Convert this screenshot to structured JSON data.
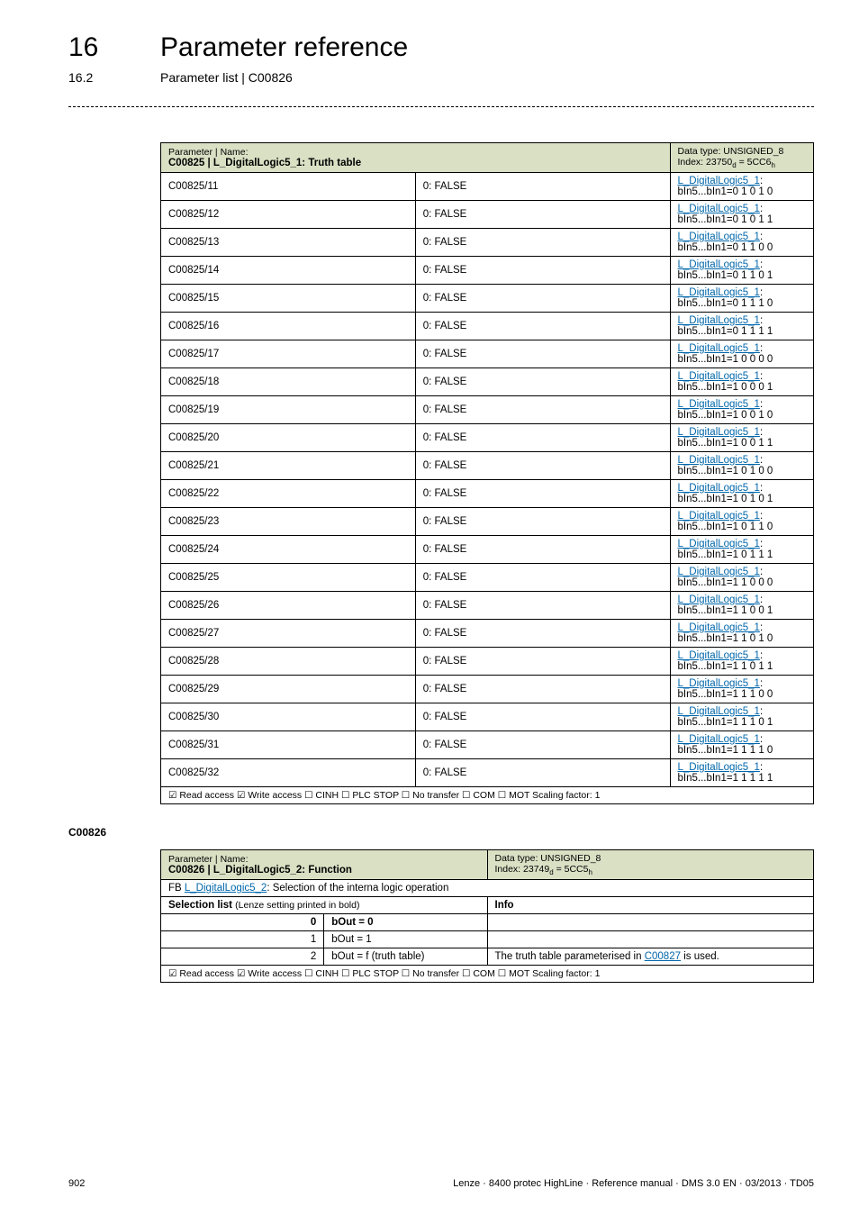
{
  "header": {
    "chapter_num": "16",
    "chapter_title": "Parameter reference",
    "section_num": "16.2",
    "section_title": "Parameter list | C00826"
  },
  "table1": {
    "param_label": "Parameter | Name:",
    "param_name": "C00825 | L_DigitalLogic5_1: Truth table",
    "datatype_label": "Data type: UNSIGNED_8",
    "index_prefix": "Index: 23750",
    "index_sub1": "d",
    "index_mid": " = 5CC6",
    "index_sub2": "h",
    "rows": [
      {
        "code": "C00825/11",
        "val": "0: FALSE",
        "link": "L_DigitalLogic5_1",
        "suffix": ": bIn5...bIn1=0 1 0 1 0"
      },
      {
        "code": "C00825/12",
        "val": "0: FALSE",
        "link": "L_DigitalLogic5_1",
        "suffix": ": bIn5...bIn1=0 1 0 1 1"
      },
      {
        "code": "C00825/13",
        "val": "0: FALSE",
        "link": "L_DigitalLogic5_1",
        "suffix": ": bIn5...bIn1=0 1 1 0 0"
      },
      {
        "code": "C00825/14",
        "val": "0: FALSE",
        "link": "L_DigitalLogic5_1",
        "suffix": ": bIn5...bIn1=0 1 1 0 1"
      },
      {
        "code": "C00825/15",
        "val": "0: FALSE",
        "link": "L_DigitalLogic5_1",
        "suffix": ": bIn5...bIn1=0 1 1 1 0"
      },
      {
        "code": "C00825/16",
        "val": "0: FALSE",
        "link": "L_DigitalLogic5_1",
        "suffix": ": bIn5...bIn1=0 1 1 1 1"
      },
      {
        "code": "C00825/17",
        "val": "0: FALSE",
        "link": "L_DigitalLogic5_1",
        "suffix": ": bIn5...bIn1=1 0 0 0 0"
      },
      {
        "code": "C00825/18",
        "val": "0: FALSE",
        "link": "L_DigitalLogic5_1",
        "suffix": ": bIn5...bIn1=1 0 0 0 1"
      },
      {
        "code": "C00825/19",
        "val": "0: FALSE",
        "link": "L_DigitalLogic5_1",
        "suffix": ": bIn5...bIn1=1 0 0 1 0"
      },
      {
        "code": "C00825/20",
        "val": "0: FALSE",
        "link": "L_DigitalLogic5_1",
        "suffix": ": bIn5...bIn1=1 0 0 1 1"
      },
      {
        "code": "C00825/21",
        "val": "0: FALSE",
        "link": "L_DigitalLogic5_1",
        "suffix": ": bIn5...bIn1=1 0 1 0 0"
      },
      {
        "code": "C00825/22",
        "val": "0: FALSE",
        "link": "L_DigitalLogic5_1",
        "suffix": ": bIn5...bIn1=1 0 1 0 1"
      },
      {
        "code": "C00825/23",
        "val": "0: FALSE",
        "link": "L_DigitalLogic5_1",
        "suffix": ": bIn5...bIn1=1 0 1 1 0"
      },
      {
        "code": "C00825/24",
        "val": "0: FALSE",
        "link": "L_DigitalLogic5_1",
        "suffix": ": bIn5...bIn1=1 0 1 1 1"
      },
      {
        "code": "C00825/25",
        "val": "0: FALSE",
        "link": "L_DigitalLogic5_1",
        "suffix": ": bIn5...bIn1=1 1 0 0 0"
      },
      {
        "code": "C00825/26",
        "val": "0: FALSE",
        "link": "L_DigitalLogic5_1",
        "suffix": ": bIn5...bIn1=1 1 0 0 1"
      },
      {
        "code": "C00825/27",
        "val": "0: FALSE",
        "link": "L_DigitalLogic5_1",
        "suffix": ": bIn5...bIn1=1 1 0 1 0"
      },
      {
        "code": "C00825/28",
        "val": "0: FALSE",
        "link": "L_DigitalLogic5_1",
        "suffix": ": bIn5...bIn1=1 1 0 1 1"
      },
      {
        "code": "C00825/29",
        "val": "0: FALSE",
        "link": "L_DigitalLogic5_1",
        "suffix": ": bIn5...bIn1=1 1 1 0 0"
      },
      {
        "code": "C00825/30",
        "val": "0: FALSE",
        "link": "L_DigitalLogic5_1",
        "suffix": ": bIn5...bIn1=1 1 1 0 1"
      },
      {
        "code": "C00825/31",
        "val": "0: FALSE",
        "link": "L_DigitalLogic5_1",
        "suffix": ": bIn5...bIn1=1 1 1 1 0"
      },
      {
        "code": "C00825/32",
        "val": "0: FALSE",
        "link": "L_DigitalLogic5_1",
        "suffix": ": bIn5...bIn1=1 1 1 1 1"
      }
    ],
    "footer": "☑ Read access  ☑ Write access  ☐ CINH  ☐ PLC STOP  ☐ No transfer  ☐ COM  ☐ MOT   Scaling factor: 1"
  },
  "section2": {
    "label": "C00826"
  },
  "table2": {
    "param_label": "Parameter | Name:",
    "param_name": "C00826 | L_DigitalLogic5_2: Function",
    "datatype_label": "Data type: UNSIGNED_8",
    "index_prefix": "Index: 23749",
    "index_sub1": "d",
    "index_mid": " = 5CC5",
    "index_sub2": "h",
    "fb_prefix": "FB ",
    "fb_link": "L_DigitalLogic5_2",
    "fb_suffix": ": Selection of the interna logic operation",
    "sel_label": "Selection list ",
    "sel_label_small": "(Lenze setting printed in bold)",
    "info_label": "Info",
    "rows": [
      {
        "n": "0",
        "val": "bOut = 0",
        "bold": true,
        "info": ""
      },
      {
        "n": "1",
        "val": "bOut = 1",
        "bold": false,
        "info": ""
      },
      {
        "n": "2",
        "val": "bOut = f (truth table)",
        "bold": false,
        "info_pre": "The truth table parameterised in ",
        "info_link": "C00827",
        "info_post": " is used."
      }
    ],
    "footer": "☑ Read access  ☑ Write access  ☐ CINH  ☐ PLC STOP  ☐ No transfer  ☐ COM  ☐ MOT   Scaling factor: 1"
  },
  "footer": {
    "page": "902",
    "doc": "Lenze · 8400 protec HighLine · Reference manual · DMS 3.0 EN · 03/2013 · TD05"
  }
}
